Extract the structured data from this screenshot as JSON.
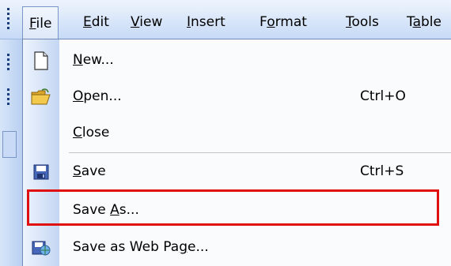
{
  "menubar": {
    "items": [
      {
        "label": "File",
        "access": "F"
      },
      {
        "label": "Edit",
        "access": "E"
      },
      {
        "label": "View",
        "access": "V"
      },
      {
        "label": "Insert",
        "access": "I"
      },
      {
        "label": "Format",
        "access": "o"
      },
      {
        "label": "Tools",
        "access": "T"
      },
      {
        "label": "Table",
        "access": "a"
      }
    ]
  },
  "file_menu": {
    "items": [
      {
        "label_access": "N",
        "label_rest": "ew...",
        "shortcut": "",
        "icon": "new-document-icon"
      },
      {
        "label_access": "O",
        "label_rest": "pen...",
        "shortcut": "Ctrl+O",
        "icon": "open-folder-icon"
      },
      {
        "label_access": "C",
        "label_rest": "lose",
        "shortcut": "",
        "icon": ""
      },
      {
        "label_access": "S",
        "label_rest": "ave",
        "shortcut": "Ctrl+S",
        "icon": "save-disk-icon"
      },
      {
        "label_pre": "Save ",
        "label_access": "A",
        "label_rest": "s...",
        "shortcut": "",
        "icon": ""
      },
      {
        "label_pre": "Save as Web Pa",
        "label_access": "g",
        "label_rest": "e...",
        "shortcut": "",
        "icon": "save-web-page-icon"
      }
    ],
    "highlighted_item": "Save As..."
  },
  "colors": {
    "highlight_border": "#e01010",
    "menubar_gradient_top": "#eef4fd",
    "menubar_gradient_bottom": "#c6daf6",
    "icon_column": "#c3d6f3"
  }
}
